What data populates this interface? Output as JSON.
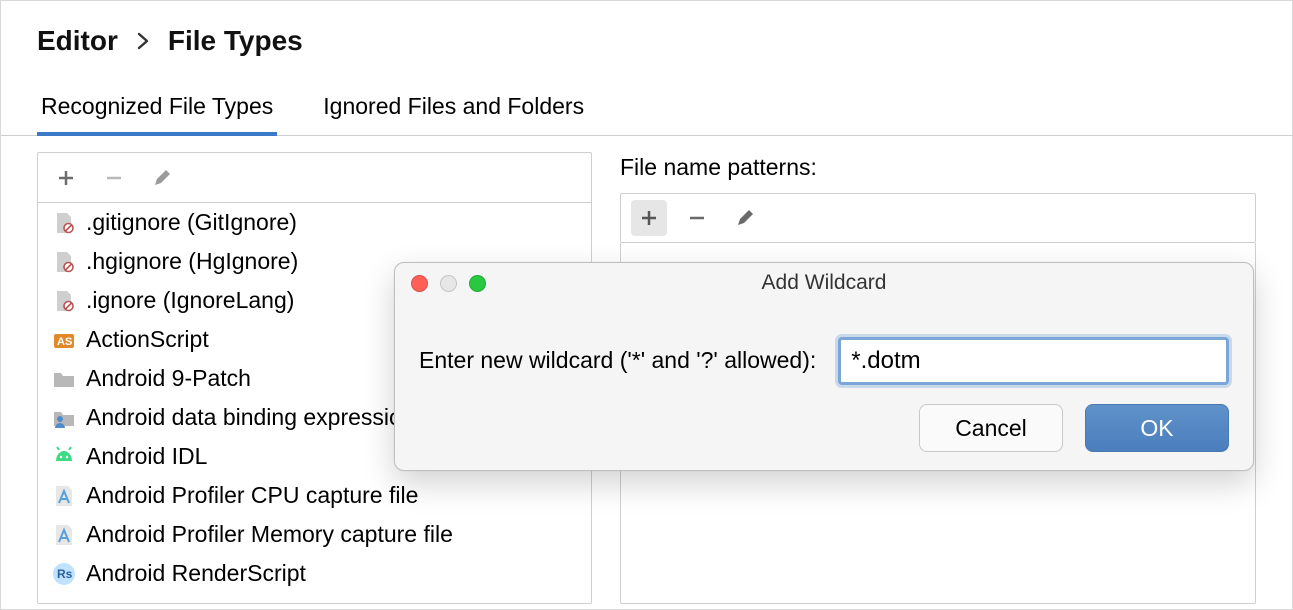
{
  "breadcrumb": {
    "parent": "Editor",
    "child": "File Types"
  },
  "tabs": {
    "recognized": "Recognized File Types",
    "ignored": "Ignored Files and Folders"
  },
  "fileTypes": {
    "items": [
      {
        "label": ".gitignore (GitIgnore)"
      },
      {
        "label": ".hgignore (HgIgnore)"
      },
      {
        "label": ".ignore (IgnoreLang)"
      },
      {
        "label": "ActionScript"
      },
      {
        "label": "Android 9-Patch"
      },
      {
        "label": "Android data binding expression"
      },
      {
        "label": "Android IDL"
      },
      {
        "label": "Android Profiler CPU capture file"
      },
      {
        "label": "Android Profiler Memory capture file"
      },
      {
        "label": "Android RenderScript"
      }
    ]
  },
  "patterns": {
    "label": "File name patterns:"
  },
  "dialog": {
    "title": "Add Wildcard",
    "prompt": "Enter new wildcard ('*' and '?' allowed):",
    "value": "*.dotm",
    "cancel": "Cancel",
    "ok": "OK"
  }
}
